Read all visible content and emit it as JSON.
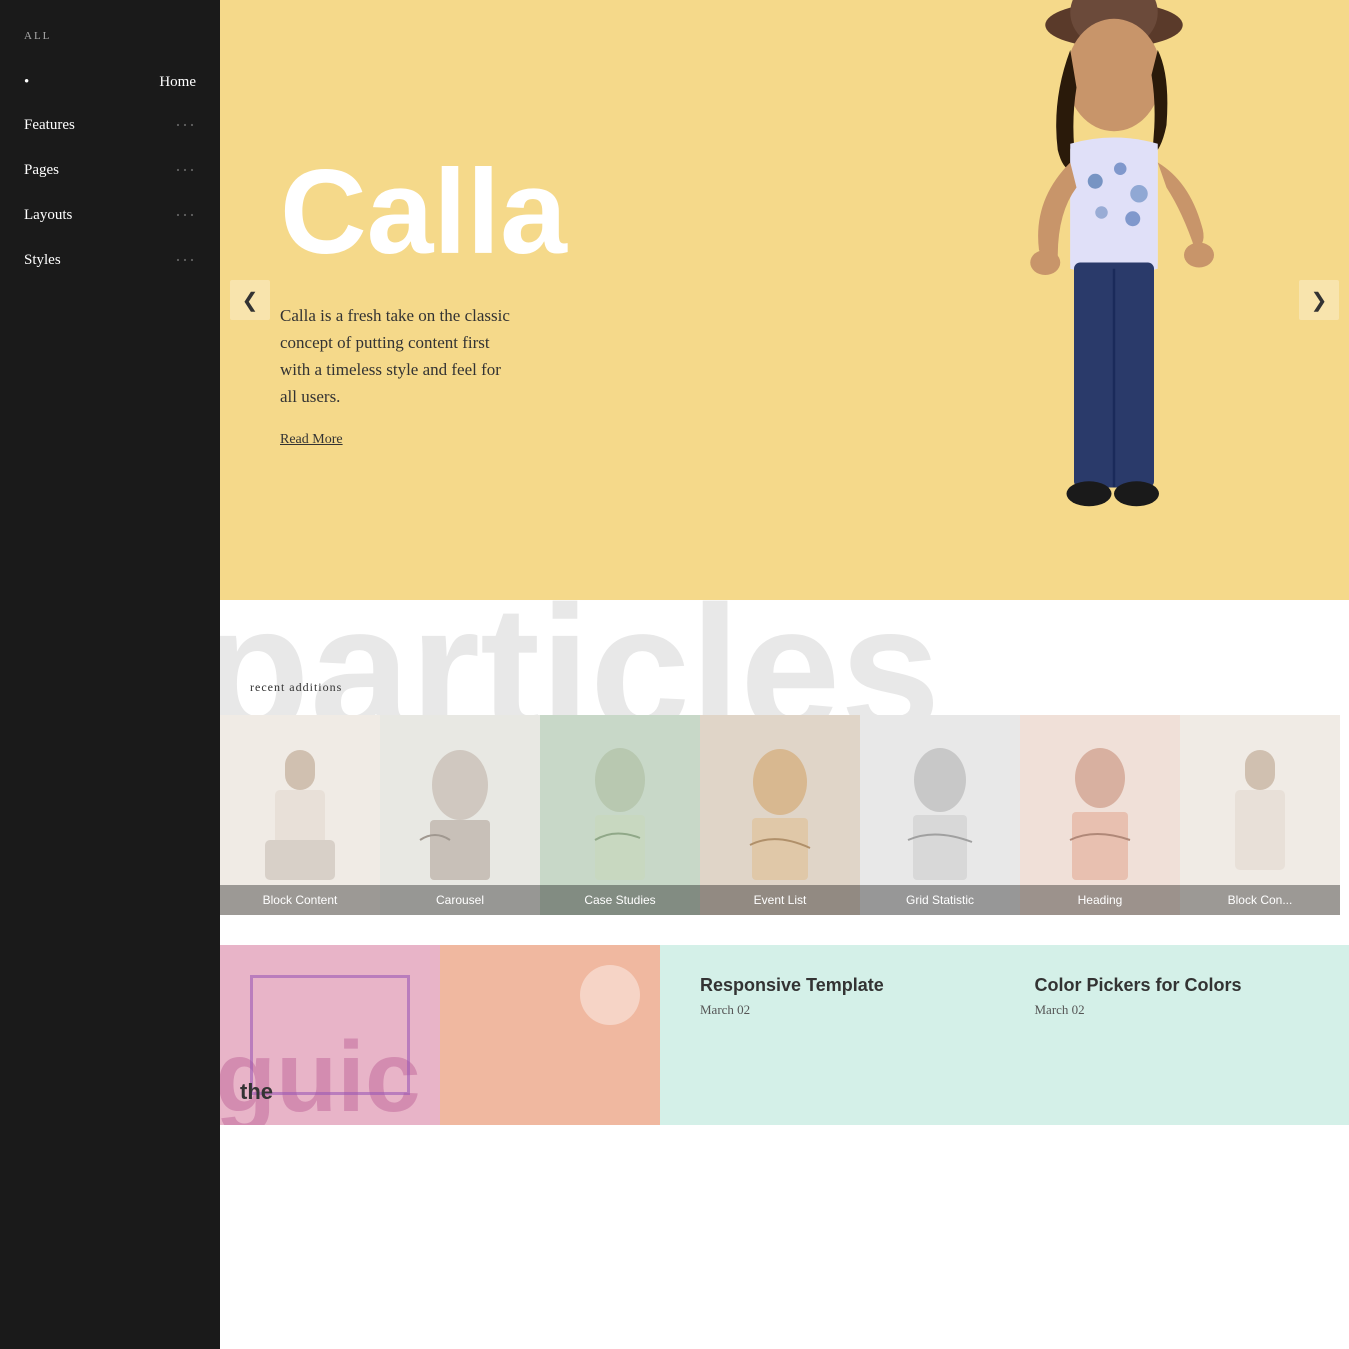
{
  "sidebar": {
    "all_label": "ALL",
    "items": [
      {
        "id": "home",
        "label": "Home",
        "active": true,
        "has_dots": false
      },
      {
        "id": "features",
        "label": "Features",
        "active": false,
        "has_dots": true
      },
      {
        "id": "pages",
        "label": "Pages",
        "active": false,
        "has_dots": true
      },
      {
        "id": "layouts",
        "label": "Layouts",
        "active": false,
        "has_dots": true
      },
      {
        "id": "styles",
        "label": "Styles",
        "active": false,
        "has_dots": true
      }
    ]
  },
  "hero": {
    "title": "Calla",
    "description": "Calla is a fresh take on the classic concept of putting content first with a timeless style and feel for all users.",
    "read_more": "Read More",
    "bg_color": "#f5d98a",
    "prev_arrow": "❮",
    "next_arrow": "❯"
  },
  "particles_section": {
    "bg_text": "particles",
    "recent_label": "recent additions"
  },
  "cards": [
    {
      "id": "block-content",
      "label": "Block Content",
      "bg": "#f0ebe5"
    },
    {
      "id": "carousel",
      "label": "Carousel",
      "bg": "#e8e8e3"
    },
    {
      "id": "case-studies",
      "label": "Case Studies",
      "bg": "#c8d8c8"
    },
    {
      "id": "event-list",
      "label": "Event List",
      "bg": "#e0d5c8"
    },
    {
      "id": "grid-statistic",
      "label": "Grid Statistic",
      "bg": "#e8e8e8"
    },
    {
      "id": "heading",
      "label": "Heading",
      "bg": "#f0e0d8"
    },
    {
      "id": "block-content-2",
      "label": "Block Con...",
      "bg": "#f0ebe5"
    }
  ],
  "bottom": {
    "guide_text": "guic",
    "the_text": "the",
    "entries": [
      {
        "title": "Responsive Template",
        "date": "March 02"
      },
      {
        "title": "Color Pickers for Colors",
        "date": "March 02"
      }
    ]
  }
}
